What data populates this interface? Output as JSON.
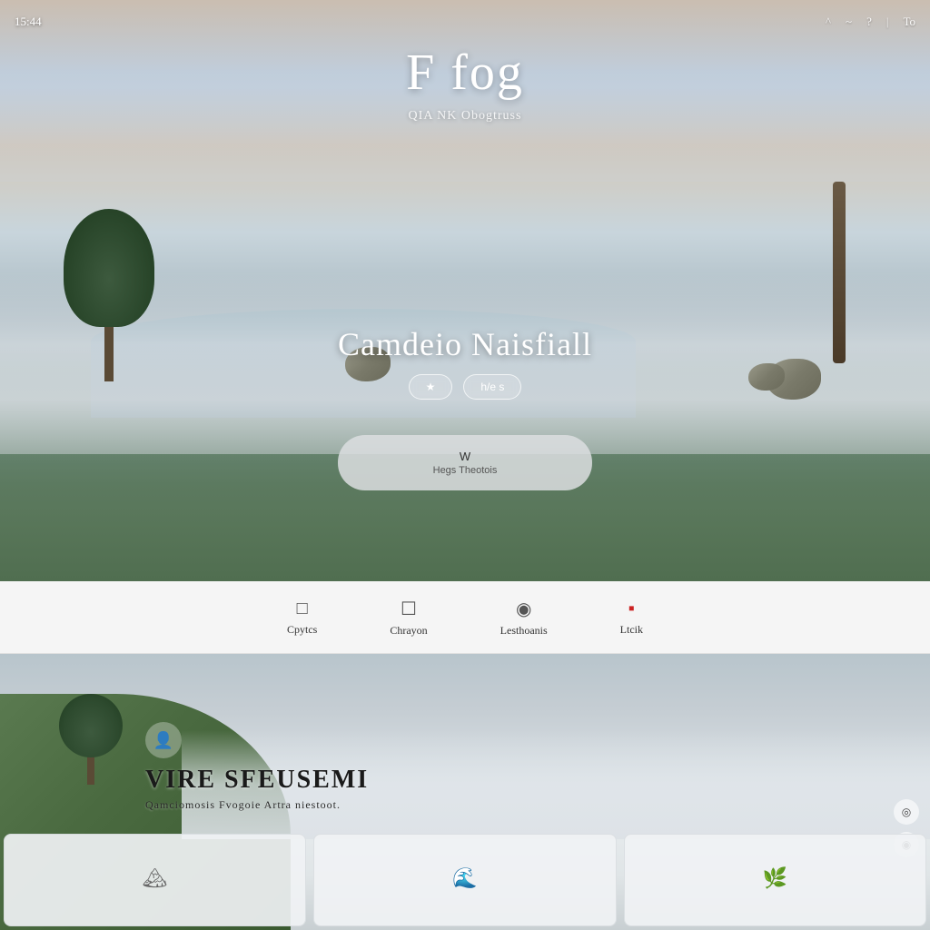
{
  "topbar": {
    "time": "15:44",
    "icons": [
      "^",
      "~",
      "?",
      "|",
      "◼"
    ],
    "window_label": "To"
  },
  "hero": {
    "title": "F fog",
    "subtitle": "QIA NK Obogtruss",
    "place_title": "Camdeio Naisfiall",
    "btn1": "★",
    "btn2": "h/e s",
    "big_button_main": "W",
    "big_button_sub": "Hegs Theotois"
  },
  "nav": {
    "items": [
      {
        "icon": "□",
        "label": "Cpytcs"
      },
      {
        "icon": "☐",
        "label": "Chrayon"
      },
      {
        "icon": "◉",
        "label": "Lesthoanis"
      },
      {
        "icon": "📦",
        "label": "Ltcik",
        "red": true
      }
    ]
  },
  "lower": {
    "badge_icon": "👤",
    "main_title": "VIRE SFEUSEMI",
    "sub_text": "Qamciomosis Fvogoie Artra niestoot.",
    "right_icons": [
      "◎",
      "◉"
    ]
  },
  "bottom_cards": [
    {
      "icon": "🏔",
      "label": ""
    },
    {
      "icon": "🌊",
      "label": ""
    },
    {
      "icon": "🌿",
      "label": ""
    }
  ]
}
